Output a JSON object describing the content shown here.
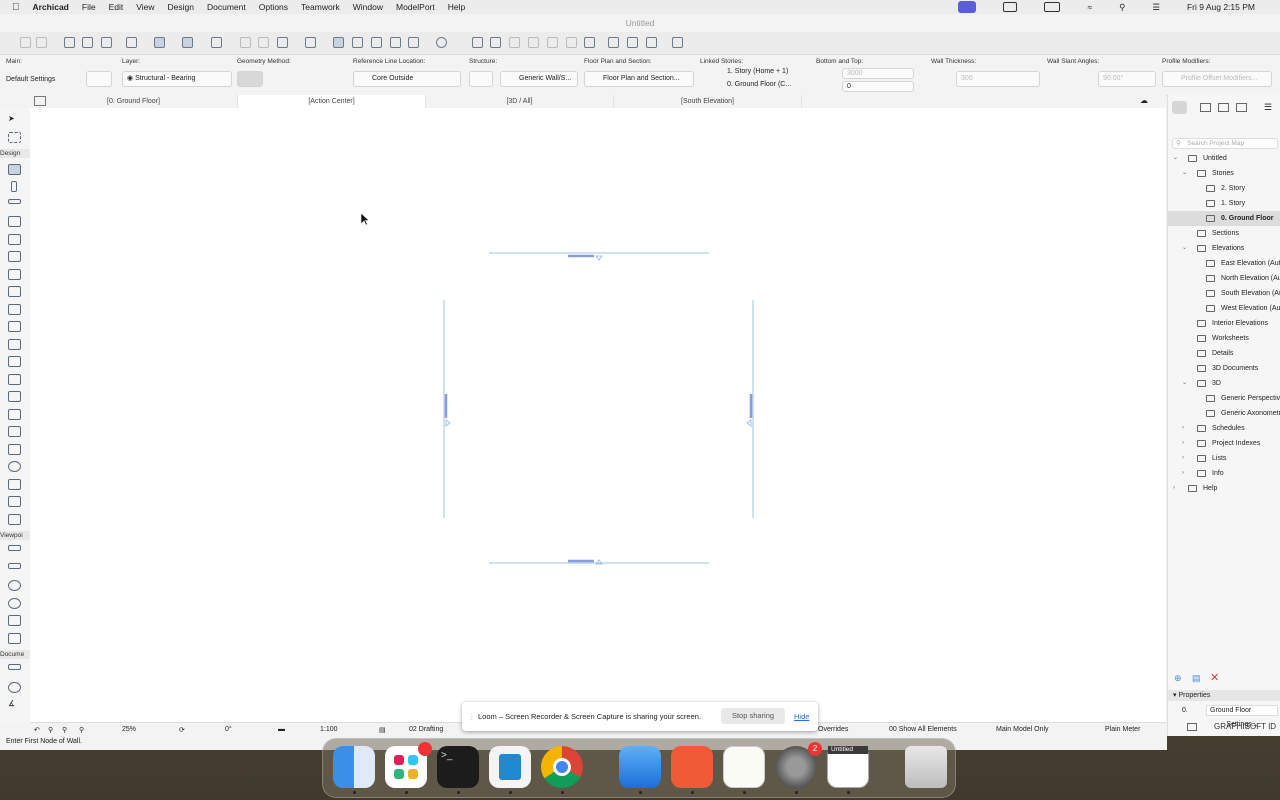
{
  "menubar": {
    "app": "Archicad",
    "items": [
      "File",
      "Edit",
      "View",
      "Design",
      "Document",
      "Options",
      "Teamwork",
      "Window",
      "ModelPort",
      "Help"
    ],
    "clock": "Fri 9 Aug  2:15 PM"
  },
  "window": {
    "title": "Untitled"
  },
  "infobox": {
    "main_label": "Main:",
    "main_value": "Default Settings",
    "layer_label": "Layer:",
    "layer_value": "Structural - Bearing",
    "geometry_label": "Geometry Method:",
    "refline_label": "Reference Line Location:",
    "refline_value": "Core Outside",
    "structure_label": "Structure:",
    "structure_value": "Generic Wall/S...",
    "floorplan_label": "Floor Plan and Section:",
    "floorplan_value": "Floor Plan and Section...",
    "linked_label": "Linked Stories:",
    "linked_top": "1. Story (Home + 1)",
    "linked_bottom": "0. Ground Floor (C...",
    "bottomtop_label": "Bottom and Top:",
    "top_value": "3000",
    "bottom_value": "0",
    "thickness_label": "Wall Thickness:",
    "thickness_value": "300",
    "slant_label": "Wall Slant Angles:",
    "slant_value": "90.00°",
    "profile_label": "Profile Modifiers:",
    "profile_value": "Profile Offset Modifiers..."
  },
  "tabs": [
    "[0. Ground Floor]",
    "[Action Center]",
    "[3D / All]",
    "[South Elevation]"
  ],
  "toolbox": {
    "design": "Design",
    "viewpoint": "Viewpoi",
    "document": "Docume"
  },
  "navigator": {
    "search_placeholder": "Search Project Map",
    "items": [
      {
        "label": "Untitled",
        "indent": 0,
        "chev": "v"
      },
      {
        "label": "Stories",
        "indent": 1,
        "chev": "v"
      },
      {
        "label": "2. Story",
        "indent": 2,
        "chev": ""
      },
      {
        "label": "1. Story",
        "indent": 2,
        "chev": ""
      },
      {
        "label": "0. Ground Floor",
        "indent": 2,
        "chev": "",
        "selected": true
      },
      {
        "label": "Sections",
        "indent": 1,
        "chev": ""
      },
      {
        "label": "Elevations",
        "indent": 1,
        "chev": "v"
      },
      {
        "label": "East Elevation (Auto-",
        "indent": 2,
        "chev": ""
      },
      {
        "label": "North Elevation (Auto",
        "indent": 2,
        "chev": ""
      },
      {
        "label": "South Elevation (Auto",
        "indent": 2,
        "chev": ""
      },
      {
        "label": "West Elevation (Auto-",
        "indent": 2,
        "chev": ""
      },
      {
        "label": "Interior Elevations",
        "indent": 1,
        "chev": ""
      },
      {
        "label": "Worksheets",
        "indent": 1,
        "chev": ""
      },
      {
        "label": "Details",
        "indent": 1,
        "chev": ""
      },
      {
        "label": "3D Documents",
        "indent": 1,
        "chev": ""
      },
      {
        "label": "3D",
        "indent": 1,
        "chev": "v"
      },
      {
        "label": "Generic Perspective",
        "indent": 2,
        "chev": ""
      },
      {
        "label": "Generic Axonometry",
        "indent": 2,
        "chev": ""
      },
      {
        "label": "Schedules",
        "indent": 1,
        "chev": ">"
      },
      {
        "label": "Project Indexes",
        "indent": 1,
        "chev": ">"
      },
      {
        "label": "Lists",
        "indent": 1,
        "chev": ">"
      },
      {
        "label": "Info",
        "indent": 1,
        "chev": ">"
      },
      {
        "label": "Help",
        "indent": 0,
        "chev": ">"
      }
    ],
    "properties_label": "Properties",
    "prop_id": "0.",
    "prop_name": "Ground Floor",
    "settings": "Settings...",
    "brand": "GRAPHISOFT ID"
  },
  "statusbar": {
    "zoom": "25%",
    "angle": "0°",
    "scale": "1:100",
    "layer_combo": "02 Drafting",
    "overrides": "Overrides",
    "filter": "00 Show All Elements",
    "model": "Main Model Only",
    "dimension": "Plain Meter",
    "hint": "Enter First Node of Wall."
  },
  "loom": {
    "message": "Loom – Screen Recorder & Screen Capture is sharing your screen.",
    "stop": "Stop sharing",
    "hide": "Hide"
  },
  "dock": {
    "apps": [
      "finder",
      "slack",
      "terminal",
      "vscode",
      "chrome",
      "xcode",
      "paw",
      "textedit",
      "system-settings",
      "archicad",
      "trash"
    ],
    "slack_badge": "",
    "settings_badge": "2",
    "archicad_label": "Untitled"
  }
}
